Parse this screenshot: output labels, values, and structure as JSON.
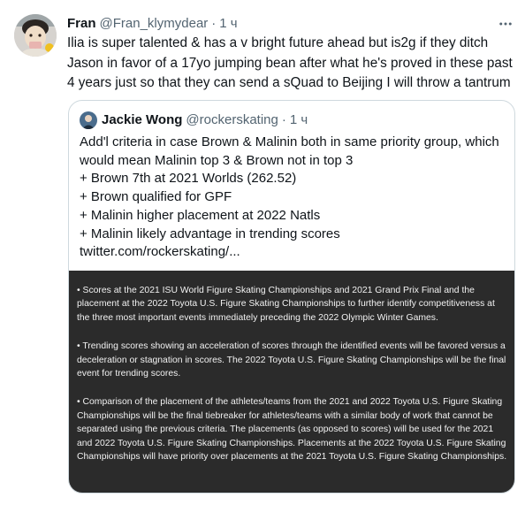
{
  "tweet": {
    "author_name": "Fran",
    "author_handle": "@Fran_klymydear",
    "separator": "·",
    "time": "1 ч",
    "text": "Ilia is super talented & has a v bright future ahead but is2g if they ditch Jason in favor of a 17yo jumping bean after what he's proved in these past 4 years just so that they can send a sQuad to Beijing I will throw a tantrum"
  },
  "quote": {
    "author_name": "Jackie Wong",
    "author_handle": "@rockerskating",
    "separator": "·",
    "time": "1 ч",
    "lines": [
      "Add'l criteria in case Brown & Malinin both in same priority group, which",
      "would mean Malinin top 3 & Brown not in top 3",
      "+ Brown 7th at 2021 Worlds (262.52)",
      "+ Brown qualified for GPF",
      "+ Malinin higher placement at 2022 Natls",
      "+ Malinin likely advantage in trending scores",
      "twitter.com/rockerskating/..."
    ],
    "image_paragraphs": [
      "• Scores at the 2021 ISU World Figure Skating Championships and 2021 Grand Prix Final and the placement at the 2022 Toyota U.S. Figure Skating Championships to further identify competitiveness at the three most important events immediately preceding the 2022 Olympic Winter Games.",
      "• Trending scores showing an acceleration of scores through the identified events will be favored versus a deceleration or stagnation in scores. The 2022 Toyota U.S. Figure Skating Championships will be the final event for trending scores.",
      "• Comparison of the placement of the athletes/teams from the 2021 and 2022 Toyota U.S. Figure Skating Championships will be the final tiebreaker for athletes/teams with a similar body of work that cannot be separated using the previous criteria. The placements (as opposed to scores) will be used for the 2021 and 2022 Toyota U.S. Figure Skating Championships. Placements at the 2022 Toyota U.S. Figure Skating Championships will have priority over placements at the 2021 Toyota U.S. Figure Skating Championships."
    ]
  },
  "icons": {
    "more": "more-horizontal-icon",
    "avatar": "user-avatar",
    "quote_avatar": "quote-user-avatar"
  },
  "colors": {
    "text_primary": "#0f1419",
    "text_secondary": "#536471",
    "border": "#cfd9de",
    "image_bg": "#2b2b2b"
  }
}
